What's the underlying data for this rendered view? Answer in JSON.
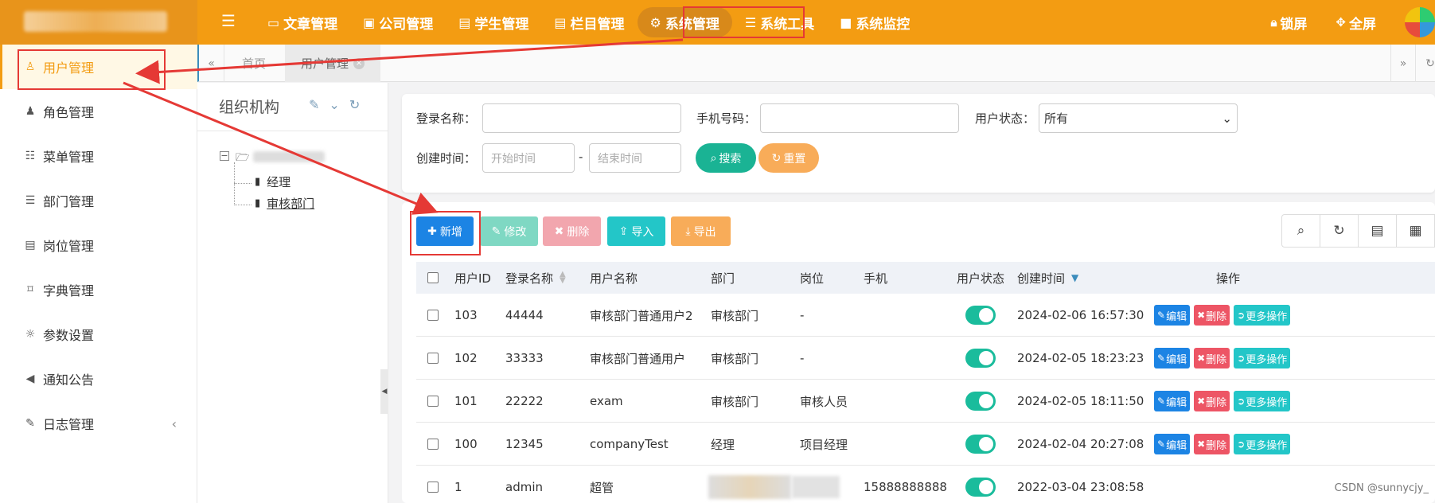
{
  "topbar": {
    "menu_toggle_icon": "bars-icon",
    "nav": [
      {
        "label": "文章管理",
        "icon": "credit-card-icon"
      },
      {
        "label": "公司管理",
        "icon": "badge-icon"
      },
      {
        "label": "学生管理",
        "icon": "id-card-icon"
      },
      {
        "label": "栏目管理",
        "icon": "id-card-icon"
      },
      {
        "label": "系统管理",
        "icon": "gear-icon",
        "active": true
      },
      {
        "label": "系统工具",
        "icon": "bars-icon"
      },
      {
        "label": "系统监控",
        "icon": "video-icon"
      }
    ],
    "lock_label": "锁屏",
    "fullscreen_label": "全屏"
  },
  "sidebar": {
    "items": [
      {
        "label": "用户管理",
        "icon": "user-icon",
        "active": true
      },
      {
        "label": "角色管理",
        "icon": "user-secret-icon"
      },
      {
        "label": "菜单管理",
        "icon": "list-icon"
      },
      {
        "label": "部门管理",
        "icon": "outdent-icon"
      },
      {
        "label": "岗位管理",
        "icon": "address-card-icon"
      },
      {
        "label": "字典管理",
        "icon": "bookmark-icon"
      },
      {
        "label": "参数设置",
        "icon": "sun-icon"
      },
      {
        "label": "通知公告",
        "icon": "bullhorn-icon"
      },
      {
        "label": "日志管理",
        "icon": "edit-icon"
      }
    ]
  },
  "tabs": [
    {
      "label": "首页"
    },
    {
      "label": "用户管理",
      "active": true
    }
  ],
  "org": {
    "title": "组织机构",
    "nodes": [
      "经理",
      "审核部门"
    ]
  },
  "search": {
    "login_name_label": "登录名称：",
    "phone_label": "手机号码：",
    "status_label": "用户状态：",
    "status_value": "所有",
    "created_label": "创建时间：",
    "start_placeholder": "开始时间",
    "dash": "-",
    "end_placeholder": "结束时间",
    "search_btn": "搜索",
    "reset_btn": "重置"
  },
  "toolbar": {
    "add": "新增",
    "edit": "修改",
    "delete": "删除",
    "import": "导入",
    "export": "导出"
  },
  "table": {
    "columns": [
      "用户ID",
      "登录名称",
      "用户名称",
      "部门",
      "岗位",
      "手机",
      "用户状态",
      "创建时间",
      "操作"
    ],
    "rows": [
      {
        "id": "103",
        "login": "44444",
        "name": "审核部门普通用户2",
        "dept": "审核部门",
        "post": "-",
        "phone": "",
        "created": "2024-02-06 16:57:30"
      },
      {
        "id": "102",
        "login": "33333",
        "name": "审核部门普通用户",
        "dept": "审核部门",
        "post": "-",
        "phone": "",
        "created": "2024-02-05 18:23:23"
      },
      {
        "id": "101",
        "login": "22222",
        "name": "exam",
        "dept": "审核部门",
        "post": "审核人员",
        "phone": "",
        "created": "2024-02-05 18:11:50"
      },
      {
        "id": "100",
        "login": "12345",
        "name": "companyTest",
        "dept": "经理",
        "post": "项目经理",
        "phone": "",
        "created": "2024-02-04 20:27:08"
      },
      {
        "id": "1",
        "login": "admin",
        "name": "超管",
        "dept": "",
        "post": "",
        "phone": "15888888888",
        "created": "2022-03-04 23:08:58"
      }
    ],
    "actions": {
      "edit": "编辑",
      "delete": "删除",
      "more": "更多操作"
    }
  },
  "watermark": "CSDN @sunnycjy_",
  "colors": {
    "brand": "#f39c12",
    "primary": "#1c84e4",
    "teal": "#1abc9c",
    "danger": "#ed5565",
    "annotation": "#e53935"
  }
}
